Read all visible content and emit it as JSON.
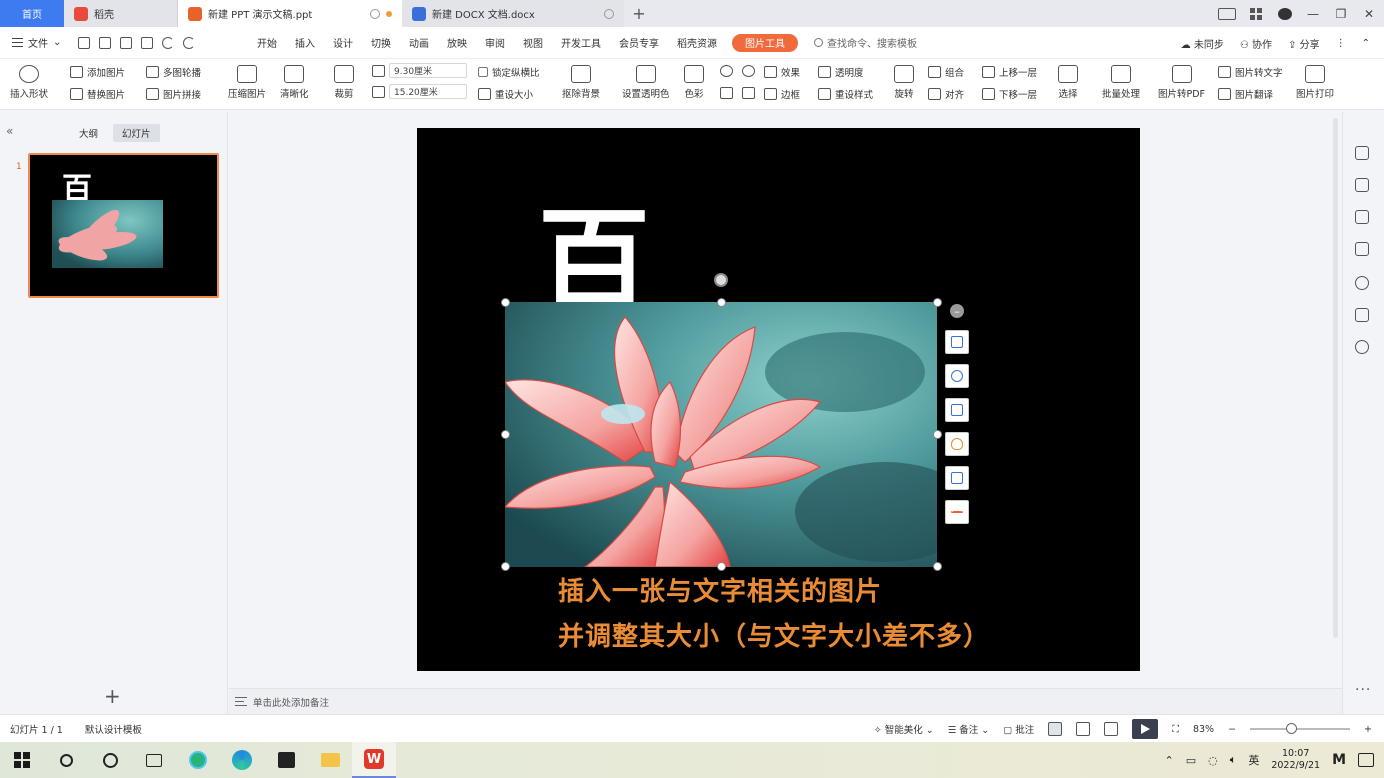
{
  "tabs": {
    "home": "首页",
    "shell": "稻壳",
    "ppt": "新建 PPT 演示文稿.ppt",
    "docx": "新建 DOCX 文档.docx",
    "add": "+"
  },
  "window_controls": {
    "minimize": "—",
    "restore": "❐",
    "close": "✕"
  },
  "menubar": {
    "file": "文件",
    "tabs": [
      "开始",
      "插入",
      "设计",
      "切换",
      "动画",
      "放映",
      "审阅",
      "视图",
      "开发工具",
      "会员专享",
      "稻壳资源"
    ],
    "active_tab": "图片工具",
    "command_search": "查找命令、搜索模板",
    "sync": "未同步",
    "collab": "协作",
    "share": "分享"
  },
  "ribbon": {
    "insert_shape": "插入形状",
    "add_picture": "添加图片",
    "replace_picture": "替换图片",
    "multi_outline": "多图轮播",
    "picture_splice": "图片拼接",
    "compress_picture": "压缩图片",
    "clear_style": "清晰化",
    "crop": "裁剪",
    "height_value": "9.30厘米",
    "width_value": "15.20厘米",
    "lock_ratio": "锁定纵横比",
    "reset_size": "重设大小",
    "remove_bg": "抠除背景",
    "set_transparent": "设置透明色",
    "color": "色彩",
    "effect": "效果",
    "transparency": "透明度",
    "border": "边框",
    "reset_style": "重设样式",
    "rotate": "旋转",
    "combine": "组合",
    "align": "对齐",
    "bring_forward": "上移一层",
    "send_backward": "下移一层",
    "select": "选择",
    "batch": "批量处理",
    "to_pdf": "图片转PDF",
    "to_text": "图片转文字",
    "translate": "图片翻译",
    "print": "图片打印"
  },
  "left_panel": {
    "tab_outline": "大纲",
    "tab_slides": "幻灯片",
    "slide_number": "1",
    "add_slide": "+"
  },
  "slide": {
    "big_char": "百",
    "line1": "插入一张与文字相关的图片",
    "line2": "并调整其大小（与文字大小差不多）"
  },
  "notes": {
    "placeholder": "单击此处添加备注"
  },
  "statusbar": {
    "slide_counter": "幻灯片 1 / 1",
    "template": "默认设计模板",
    "smart_beautify": "智能美化",
    "notes": "备注",
    "comments": "批注",
    "zoom": "83%",
    "zoom_level": 0.83
  },
  "taskbar": {
    "lang": "英",
    "time": "10:07",
    "date": "2022/9/21"
  },
  "colors": {
    "accent": "#f06a3c",
    "home_tab": "#3e7bf0",
    "slide_text": "#ea8c36"
  }
}
